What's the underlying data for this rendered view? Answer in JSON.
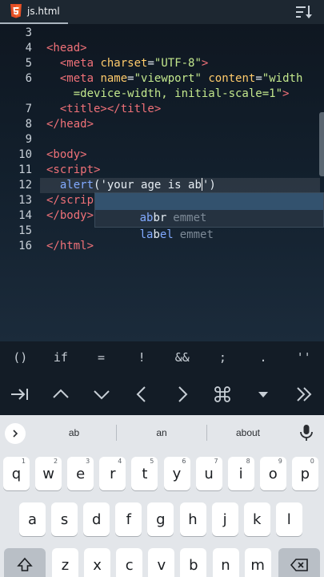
{
  "tabbar": {
    "file_name": "js.html",
    "colors": {
      "html5_badge": "#e44d26",
      "active_underline": "#aab4be"
    }
  },
  "editor": {
    "lines": [
      {
        "num": "3",
        "html": ""
      },
      {
        "num": "4",
        "html": "<span class='tag'>&lt;head&gt;</span>"
      },
      {
        "num": "5",
        "html": "  <span class='tag'>&lt;meta</span> <span class='attr'>charset</span><span class='ptxt'>=</span><span class='str'>\"UTF-8\"</span><span class='tag'>&gt;</span>"
      },
      {
        "num": "6",
        "html": "  <span class='tag'>&lt;meta</span> <span class='attr'>name</span><span class='ptxt'>=</span><span class='str'>\"viewport\"</span> <span class='attr'>content</span><span class='ptxt'>=</span><span class='str'>\"width</span>"
      },
      {
        "num": "",
        "html": "    <span class='str'>=device-width, initial-scale=1\"</span><span class='tag'>&gt;</span>"
      },
      {
        "num": "7",
        "html": "  <span class='tag'>&lt;title&gt;&lt;/title&gt;</span>"
      },
      {
        "num": "8",
        "html": "<span class='tag'>&lt;/head&gt;</span>"
      },
      {
        "num": "9",
        "html": ""
      },
      {
        "num": "10",
        "html": "<span class='tag'>&lt;body&gt;</span>"
      },
      {
        "num": "11",
        "html": "<span class='tag'>&lt;script&gt;</span>"
      },
      {
        "num": "12",
        "html": "  <span class='fn'>alert</span><span class='ptxt'>(</span><span class='strtxt'>'your age is ab</span><span class='cursor'></span><span class='strtxt'>'</span><span class='ptxt'>)</span>"
      },
      {
        "num": "13",
        "html": "<span class='tag'>&lt;/scrip</span>"
      },
      {
        "num": "14",
        "html": "<span class='tag'>&lt;/body&gt;</span>"
      },
      {
        "num": "15",
        "html": ""
      },
      {
        "num": "16",
        "html": "<span class='tag'>&lt;/html&gt;</span>"
      }
    ],
    "active_line": "12",
    "autocomplete": [
      {
        "match": "ab",
        "rest": "br",
        "type": "emmet",
        "selected": true
      },
      {
        "match": "la",
        "rest": "b",
        "extra": "el",
        "type": "emmet",
        "selected": false
      }
    ]
  },
  "symbols": [
    "()",
    "if",
    "=",
    "!",
    "&&",
    ";",
    ".",
    "''"
  ],
  "nav_keys": [
    "tab-icon",
    "arrow-up-icon",
    "arrow-down-icon",
    "arrow-left-icon",
    "arrow-right-icon",
    "command-icon",
    "caret-down-icon",
    "double-chevron-right-icon"
  ],
  "keyboard": {
    "suggestions": [
      "ab",
      "an",
      "about"
    ],
    "row1": [
      {
        "k": "q",
        "h": "1"
      },
      {
        "k": "w",
        "h": "2"
      },
      {
        "k": "e",
        "h": "3"
      },
      {
        "k": "r",
        "h": "4"
      },
      {
        "k": "t",
        "h": "5"
      },
      {
        "k": "y",
        "h": "6"
      },
      {
        "k": "u",
        "h": "7"
      },
      {
        "k": "i",
        "h": "8"
      },
      {
        "k": "o",
        "h": "9"
      },
      {
        "k": "p",
        "h": "0"
      }
    ],
    "row2": [
      "a",
      "s",
      "d",
      "f",
      "g",
      "h",
      "j",
      "k",
      "l"
    ],
    "row3": [
      "z",
      "x",
      "c",
      "v",
      "b",
      "n",
      "m"
    ]
  }
}
